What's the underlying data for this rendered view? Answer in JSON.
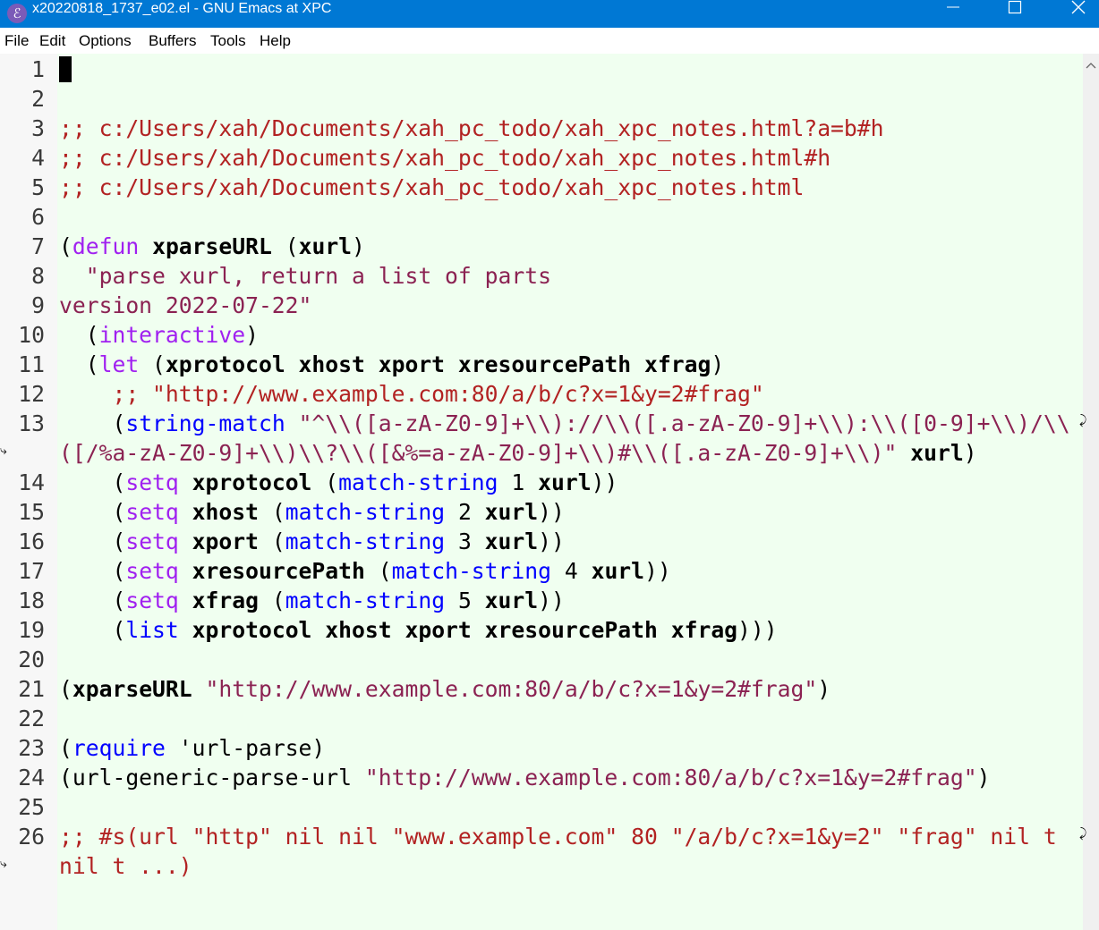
{
  "window": {
    "title": "x20220818_1737_e02.el - GNU Emacs at XPC",
    "icon": "emacs-icon"
  },
  "menu": [
    "File",
    "Edit",
    "Options",
    "Buffers",
    "Tools",
    "Help"
  ],
  "editor": {
    "background": "#f0fff0",
    "lines": [
      {
        "n": "1",
        "segments": []
      },
      {
        "n": "2",
        "segments": []
      },
      {
        "n": "3",
        "segments": [
          {
            "t": ";; c:/Users/xah/Documents/xah_pc_todo/xah_xpc_notes.html?a=b#h",
            "c": "cmt"
          }
        ]
      },
      {
        "n": "4",
        "segments": [
          {
            "t": ";; c:/Users/xah/Documents/xah_pc_todo/xah_xpc_notes.html#h",
            "c": "cmt"
          }
        ]
      },
      {
        "n": "5",
        "segments": [
          {
            "t": ";; c:/Users/xah/Documents/xah_pc_todo/xah_xpc_notes.html",
            "c": "cmt"
          }
        ]
      },
      {
        "n": "6",
        "segments": []
      },
      {
        "n": "7",
        "segments": [
          {
            "t": "(",
            "c": "plain"
          },
          {
            "t": "defun",
            "c": "kw"
          },
          {
            "t": " ",
            "c": "plain"
          },
          {
            "t": "xparseURL",
            "c": "fn"
          },
          {
            "t": " (",
            "c": "plain"
          },
          {
            "t": "xurl",
            "c": "var"
          },
          {
            "t": ")",
            "c": "plain"
          }
        ]
      },
      {
        "n": "8",
        "segments": [
          {
            "t": "  ",
            "c": "plain"
          },
          {
            "t": "\"parse xurl, return a list of parts",
            "c": "str"
          }
        ]
      },
      {
        "n": "9",
        "segments": [
          {
            "t": "version 2022-07-22\"",
            "c": "str"
          }
        ]
      },
      {
        "n": "10",
        "segments": [
          {
            "t": "  (",
            "c": "plain"
          },
          {
            "t": "interactive",
            "c": "kw"
          },
          {
            "t": ")",
            "c": "plain"
          }
        ]
      },
      {
        "n": "11",
        "segments": [
          {
            "t": "  (",
            "c": "plain"
          },
          {
            "t": "let",
            "c": "kw"
          },
          {
            "t": " (",
            "c": "plain"
          },
          {
            "t": "xprotocol xhost xport xresourcePath xfrag",
            "c": "var"
          },
          {
            "t": ")",
            "c": "plain"
          }
        ]
      },
      {
        "n": "12",
        "segments": [
          {
            "t": "    ",
            "c": "plain"
          },
          {
            "t": ";; \"http://www.example.com:80/a/b/c?x=1&y=2#frag\"",
            "c": "cmt"
          }
        ]
      },
      {
        "n": "13",
        "segments": [
          {
            "t": "    (",
            "c": "plain"
          },
          {
            "t": "string-match",
            "c": "bi"
          },
          {
            "t": " ",
            "c": "plain"
          },
          {
            "t": "\"^\\\\([a-zA-Z0-9]+\\\\)://\\\\([.a-zA-Z0-9]+\\\\):\\\\([0-9]+\\\\)/\\\\",
            "c": "str"
          }
        ]
      },
      {
        "n": "",
        "segments": [
          {
            "t": "([/%a-zA-Z0-9]+\\\\)\\\\?\\\\([&%=a-zA-Z0-9]+\\\\)#\\\\([.a-zA-Z0-9]+\\\\)\"",
            "c": "str"
          },
          {
            "t": " ",
            "c": "plain"
          },
          {
            "t": "xurl",
            "c": "var"
          },
          {
            "t": ")",
            "c": "plain"
          }
        ]
      },
      {
        "n": "14",
        "segments": [
          {
            "t": "    (",
            "c": "plain"
          },
          {
            "t": "setq",
            "c": "kw"
          },
          {
            "t": " ",
            "c": "plain"
          },
          {
            "t": "xprotocol",
            "c": "var"
          },
          {
            "t": " (",
            "c": "plain"
          },
          {
            "t": "match-string",
            "c": "bi"
          },
          {
            "t": " 1 ",
            "c": "plain"
          },
          {
            "t": "xurl",
            "c": "var"
          },
          {
            "t": "))",
            "c": "plain"
          }
        ]
      },
      {
        "n": "15",
        "segments": [
          {
            "t": "    (",
            "c": "plain"
          },
          {
            "t": "setq",
            "c": "kw"
          },
          {
            "t": " ",
            "c": "plain"
          },
          {
            "t": "xhost",
            "c": "var"
          },
          {
            "t": " (",
            "c": "plain"
          },
          {
            "t": "match-string",
            "c": "bi"
          },
          {
            "t": " 2 ",
            "c": "plain"
          },
          {
            "t": "xurl",
            "c": "var"
          },
          {
            "t": "))",
            "c": "plain"
          }
        ]
      },
      {
        "n": "16",
        "segments": [
          {
            "t": "    (",
            "c": "plain"
          },
          {
            "t": "setq",
            "c": "kw"
          },
          {
            "t": " ",
            "c": "plain"
          },
          {
            "t": "xport",
            "c": "var"
          },
          {
            "t": " (",
            "c": "plain"
          },
          {
            "t": "match-string",
            "c": "bi"
          },
          {
            "t": " 3 ",
            "c": "plain"
          },
          {
            "t": "xurl",
            "c": "var"
          },
          {
            "t": "))",
            "c": "plain"
          }
        ]
      },
      {
        "n": "17",
        "segments": [
          {
            "t": "    (",
            "c": "plain"
          },
          {
            "t": "setq",
            "c": "kw"
          },
          {
            "t": " ",
            "c": "plain"
          },
          {
            "t": "xresourcePath",
            "c": "var"
          },
          {
            "t": " (",
            "c": "plain"
          },
          {
            "t": "match-string",
            "c": "bi"
          },
          {
            "t": " 4 ",
            "c": "plain"
          },
          {
            "t": "xurl",
            "c": "var"
          },
          {
            "t": "))",
            "c": "plain"
          }
        ]
      },
      {
        "n": "18",
        "segments": [
          {
            "t": "    (",
            "c": "plain"
          },
          {
            "t": "setq",
            "c": "kw"
          },
          {
            "t": " ",
            "c": "plain"
          },
          {
            "t": "xfrag",
            "c": "var"
          },
          {
            "t": " (",
            "c": "plain"
          },
          {
            "t": "match-string",
            "c": "bi"
          },
          {
            "t": " 5 ",
            "c": "plain"
          },
          {
            "t": "xurl",
            "c": "var"
          },
          {
            "t": "))",
            "c": "plain"
          }
        ]
      },
      {
        "n": "19",
        "segments": [
          {
            "t": "    (",
            "c": "plain"
          },
          {
            "t": "list",
            "c": "bi"
          },
          {
            "t": " ",
            "c": "plain"
          },
          {
            "t": "xprotocol xhost xport xresourcePath xfrag",
            "c": "var"
          },
          {
            "t": ")))",
            "c": "plain"
          }
        ]
      },
      {
        "n": "20",
        "segments": []
      },
      {
        "n": "21",
        "segments": [
          {
            "t": "(",
            "c": "plain"
          },
          {
            "t": "xparseURL",
            "c": "var"
          },
          {
            "t": " ",
            "c": "plain"
          },
          {
            "t": "\"http://www.example.com:80/a/b/c?x=1&y=2#frag\"",
            "c": "str"
          },
          {
            "t": ")",
            "c": "plain"
          }
        ]
      },
      {
        "n": "22",
        "segments": []
      },
      {
        "n": "23",
        "segments": [
          {
            "t": "(",
            "c": "plain"
          },
          {
            "t": "require",
            "c": "bi"
          },
          {
            "t": " 'url-parse)",
            "c": "plain"
          }
        ]
      },
      {
        "n": "24",
        "segments": [
          {
            "t": "(url-generic-parse-url ",
            "c": "plain"
          },
          {
            "t": "\"http://www.example.com:80/a/b/c?x=1&y=2#frag\"",
            "c": "str"
          },
          {
            "t": ")",
            "c": "plain"
          }
        ]
      },
      {
        "n": "25",
        "segments": []
      },
      {
        "n": "26",
        "segments": [
          {
            "t": ";; #s(url \"http\" nil nil \"www.example.com\" 80 \"/a/b/c?x=1&y=2\" \"frag\" nil t",
            "c": "cmt"
          }
        ]
      },
      {
        "n": "",
        "segments": [
          {
            "t": "nil t ...)",
            "c": "cmt"
          }
        ]
      }
    ]
  },
  "window_controls": [
    "minimize-icon",
    "maximize-icon",
    "close-icon"
  ]
}
